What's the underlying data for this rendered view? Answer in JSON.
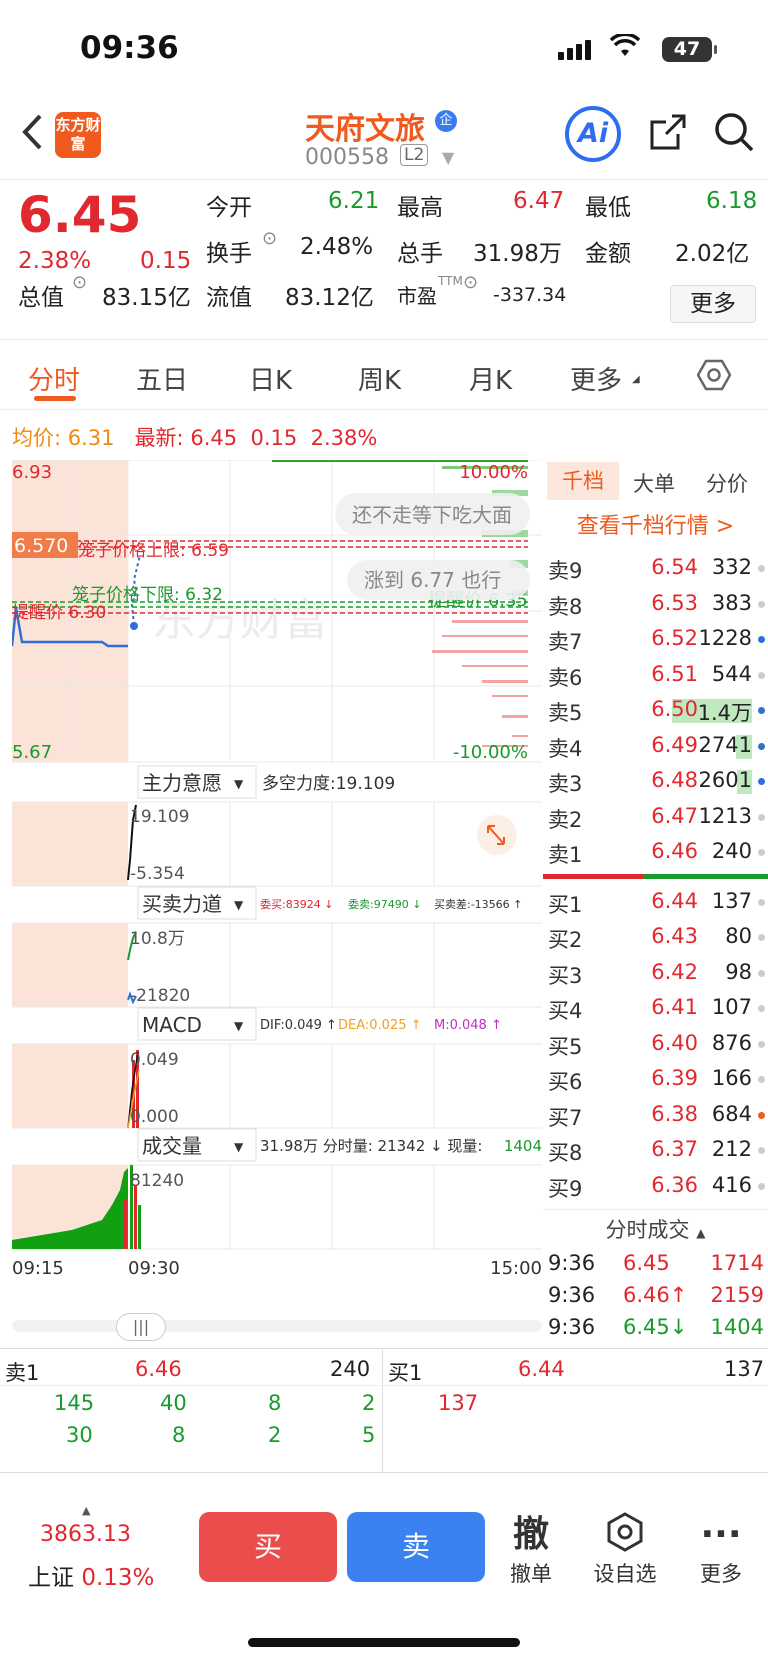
{
  "status": {
    "time": "09:36",
    "battery": "47"
  },
  "header": {
    "logo": "东方财富",
    "stock_name": "天府文旅",
    "badge": "企",
    "code": "000558",
    "level": "L2",
    "ai_label": "Ai"
  },
  "quote": {
    "price": "6.45",
    "change_pct": "2.38%",
    "change": "0.15",
    "open_label": "今开",
    "open": "6.21",
    "high_label": "最高",
    "high": "6.47",
    "low_label": "最低",
    "low": "6.18",
    "turnover_label": "换手",
    "turnover": "2.48%",
    "volume_label": "总手",
    "volume": "31.98万",
    "amount_label": "金额",
    "amount": "2.02亿",
    "mcap_label": "总值",
    "mcap": "83.15亿",
    "float_label": "流值",
    "float": "83.12亿",
    "pe_label": "市盈",
    "pe_sup": "TTM",
    "pe": "-337.34",
    "more": "更多"
  },
  "tabs": [
    "分时",
    "五日",
    "日K",
    "周K",
    "月K",
    "更多"
  ],
  "infoline": {
    "avg_label": "均价:",
    "avg": "6.31",
    "last_label": "最新:",
    "last": "6.45",
    "chg": "0.15",
    "pct": "2.38%"
  },
  "chart": {
    "y_high": "6.93",
    "y_low": "5.67",
    "pct_high": "10.00%",
    "pct_low": "-10.00%",
    "mark_price": "6.570",
    "upper_label": "笼子价格上限: 6.59",
    "lower_label": "笼子价格下限: 6.32",
    "remind_left": "提醒价 6.30",
    "remind_right": "提醒价 6.35",
    "bubble1": "还不走等下吃大面",
    "bubble2": "涨到 6.77 也行",
    "watermark": "东方财富",
    "sub1_name": "主力意愿",
    "sub1_info": "多空力度:19.109",
    "sub1_top": "19.109",
    "sub1_bot": "-5.354",
    "sub2_name": "买卖力道",
    "sub2_info_buy": "委买:83924 ↓",
    "sub2_info_sell": "委卖:97490 ↓",
    "sub2_info_diff": "买卖差:-13566 ↑",
    "sub2_top": "10.8万",
    "sub2_bot": "-21820",
    "sub3_name": "MACD",
    "sub3_dif": "DIF:0.049 ↑",
    "sub3_dea": "DEA:0.025 ↑",
    "sub3_m": "M:0.048 ↑",
    "sub3_top": "0.049",
    "sub3_bot": "0.000",
    "sub4_name": "成交量",
    "sub4_info_a": "31.98万 分时量: 21342 ↓ 现量:",
    "sub4_info_b": "1404",
    "sub4_top": "81240",
    "t_start": "09:15",
    "t_mid": "09:30",
    "t_end": "15:00"
  },
  "orderbook": {
    "tabs": [
      "千档",
      "大单",
      "分价"
    ],
    "link": "查看千档行情 >",
    "asks": [
      {
        "label": "卖9",
        "price": "6.54",
        "vol": "332",
        "bar": 0.0
      },
      {
        "label": "卖8",
        "price": "6.53",
        "vol": "383",
        "bar": 0.0
      },
      {
        "label": "卖7",
        "price": "6.52",
        "vol": "1228",
        "bar": 0.0
      },
      {
        "label": "卖6",
        "price": "6.51",
        "vol": "544",
        "bar": 0.0
      },
      {
        "label": "卖5",
        "price": "6.50",
        "vol": "1.4万",
        "bar": 1.0
      },
      {
        "label": "卖4",
        "price": "6.49",
        "vol": "2741",
        "bar": 0.2
      },
      {
        "label": "卖3",
        "price": "6.48",
        "vol": "2601",
        "bar": 0.19
      },
      {
        "label": "卖2",
        "price": "6.47",
        "vol": "1213",
        "bar": 0.0
      },
      {
        "label": "卖1",
        "price": "6.46",
        "vol": "240",
        "bar": 0.0
      }
    ],
    "bids": [
      {
        "label": "买1",
        "price": "6.44",
        "vol": "137"
      },
      {
        "label": "买2",
        "price": "6.43",
        "vol": "80"
      },
      {
        "label": "买3",
        "price": "6.42",
        "vol": "98"
      },
      {
        "label": "买4",
        "price": "6.41",
        "vol": "107"
      },
      {
        "label": "买5",
        "price": "6.40",
        "vol": "876"
      },
      {
        "label": "买6",
        "price": "6.39",
        "vol": "166"
      },
      {
        "label": "买7",
        "price": "6.38",
        "vol": "684"
      },
      {
        "label": "买8",
        "price": "6.37",
        "vol": "212"
      },
      {
        "label": "买9",
        "price": "6.36",
        "vol": "416"
      }
    ],
    "ts_title": "分时成交",
    "ticks": [
      {
        "time": "9:36",
        "price": "6.45",
        "vol": "1714",
        "color": "#e0282e"
      },
      {
        "time": "9:36",
        "price": "6.46↑",
        "vol": "2159",
        "color": "#e0282e"
      },
      {
        "time": "9:36",
        "price": "6.45↓",
        "vol": "1404",
        "color": "#1a9a2c"
      }
    ]
  },
  "detail": {
    "sell_label": "卖1",
    "sell_price": "6.46",
    "sell_vol": "240",
    "buy_label": "买1",
    "buy_price": "6.44",
    "buy_vol": "137",
    "sell_q_row1": [
      "145",
      "40",
      "8",
      "2"
    ],
    "sell_q_row2": [
      "30",
      "8",
      "2",
      "5"
    ],
    "buy_q": "137"
  },
  "bottom": {
    "index_value": "3863.13",
    "index_name": "上证",
    "index_pct": "0.13%",
    "buy": "买",
    "sell": "卖",
    "cancel_glyph": "撤",
    "cancel": "撤单",
    "watch": "设自选",
    "more": "更多"
  }
}
